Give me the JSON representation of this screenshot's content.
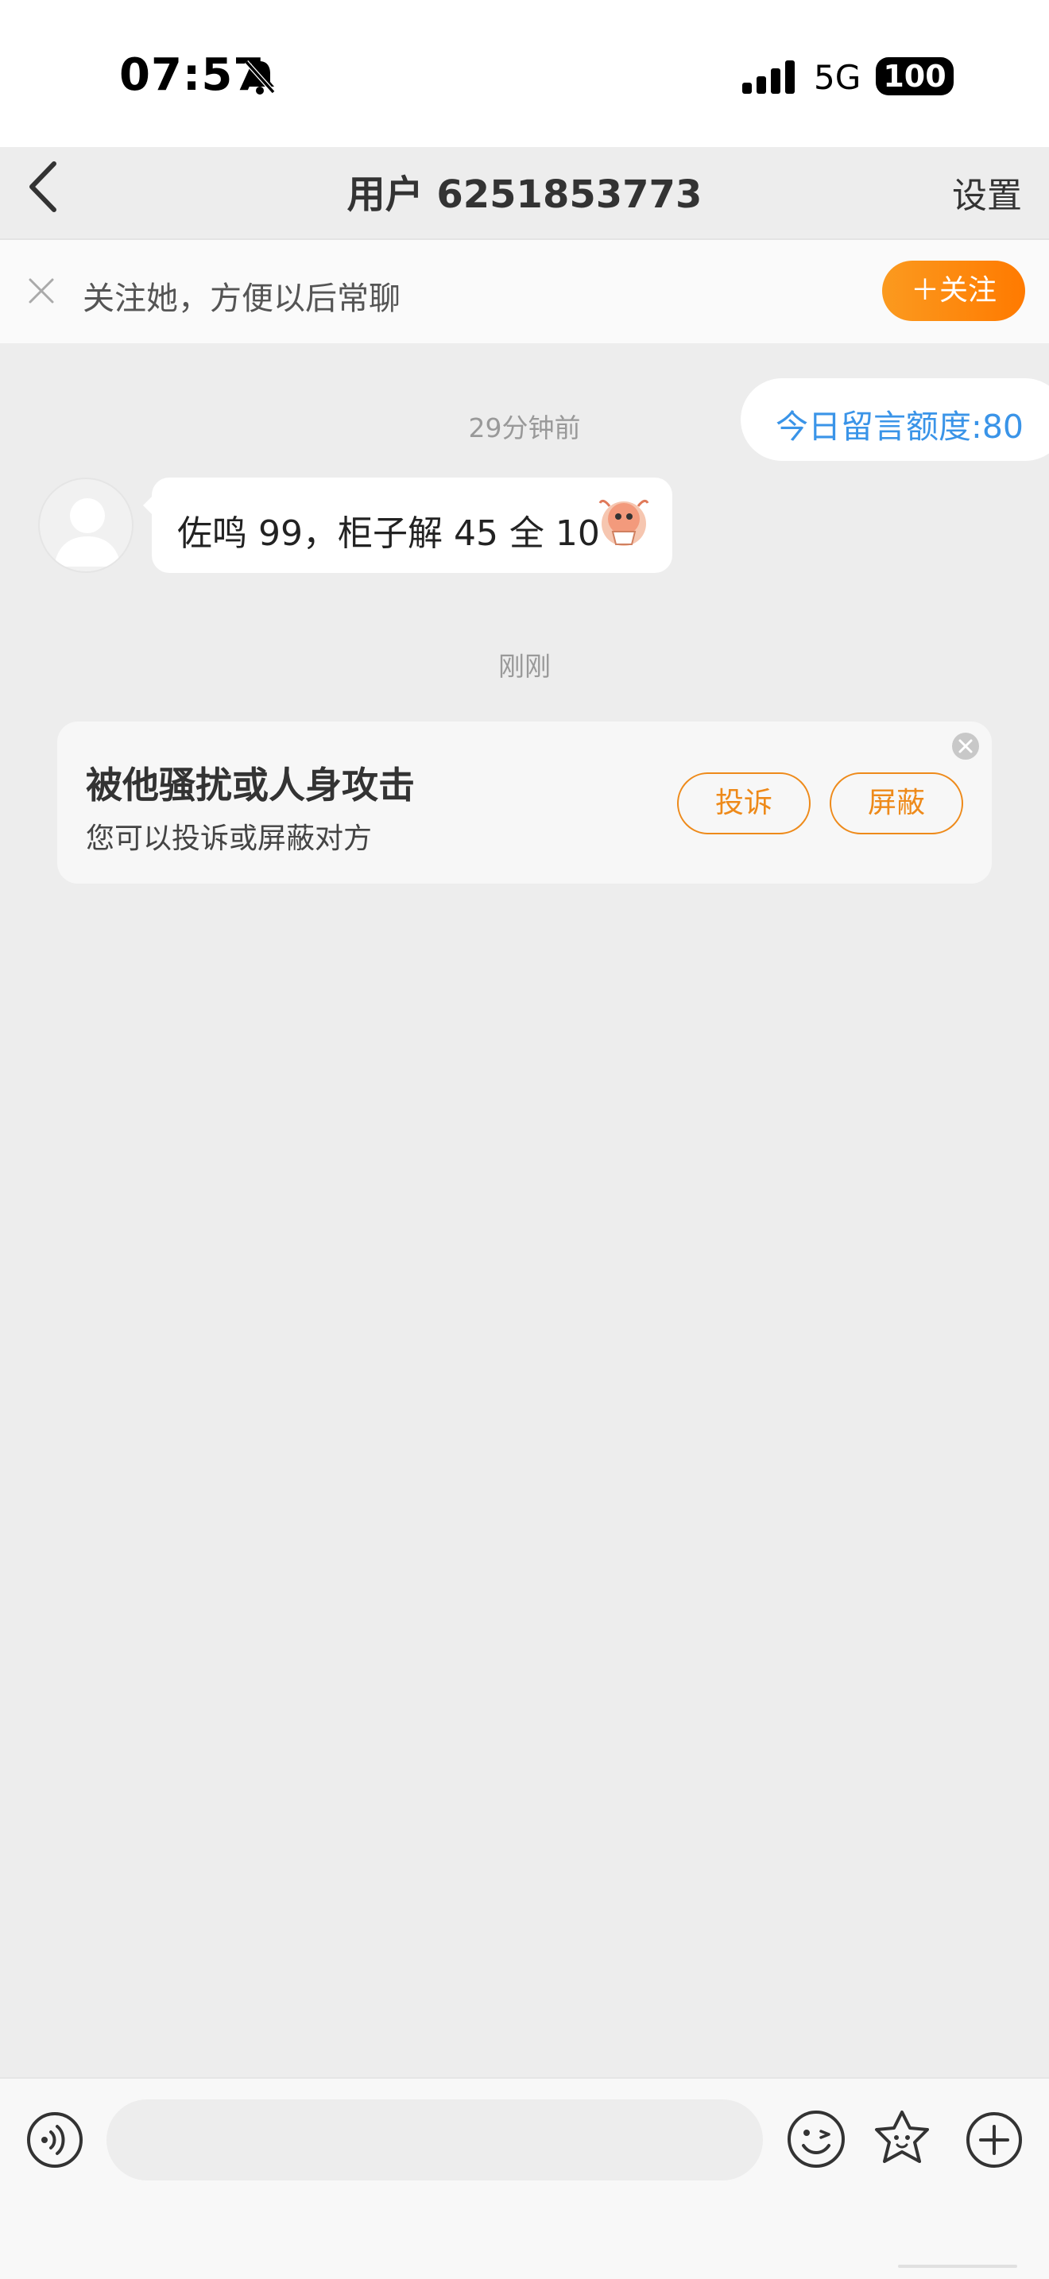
{
  "status_bar": {
    "time": "07:57",
    "network": "5G",
    "battery": "100",
    "icons": [
      "bell-muted-icon",
      "signal-icon",
      "battery-icon"
    ]
  },
  "nav": {
    "title": "用户 6251853773",
    "settings_label": "设置",
    "back_icon": "chevron-left-icon"
  },
  "follow_banner": {
    "text": "关注她，方便以后常聊",
    "follow_button_label": "＋关注",
    "accent_color": "#ff8a00"
  },
  "chat": {
    "quota_text": "今日留言额度:80",
    "messages": [
      {
        "timestamp": "29分钟前",
        "text": "佐鸣 99，柜子解 45 全 10",
        "sticker": "shrimp-sticker-icon"
      }
    ],
    "second_timestamp": "刚刚"
  },
  "report_card": {
    "title": "被他骚扰或人身攻击",
    "subtitle": "您可以投诉或屏蔽对方",
    "report_button_label": "投诉",
    "block_button_label": "屏蔽",
    "accent_color": "#ee8a1a"
  },
  "input_bar": {
    "placeholder": "",
    "icons": [
      "voice-icon",
      "emoji-icon",
      "sticker-icon",
      "plus-icon"
    ]
  }
}
